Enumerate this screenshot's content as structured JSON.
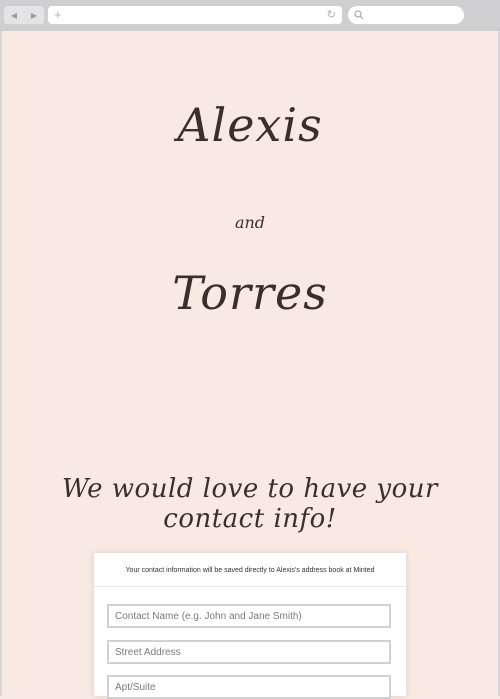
{
  "browser": {
    "back_icon": "back-arrow-icon",
    "forward_icon": "forward-arrow-icon",
    "new_tab_icon": "plus-icon",
    "reload_icon": "reload-icon",
    "search_icon": "search-icon"
  },
  "invitation": {
    "name_one": "Alexis",
    "conjunction": "and",
    "name_two": "Torres",
    "tagline": "We would love to have your contact info!"
  },
  "form": {
    "notice": "Your contact information will be saved directly to Alexis's address book at Minted",
    "contact_name_placeholder": "Contact Name (e.g. John and Jane Smith)",
    "street_address_placeholder": "Street Address",
    "apt_suite_placeholder": "Apt/Suite"
  },
  "colors": {
    "page_background": "#f9e9e3",
    "script_text": "#3a2f2d",
    "browser_chrome": "#cfcfd1"
  }
}
